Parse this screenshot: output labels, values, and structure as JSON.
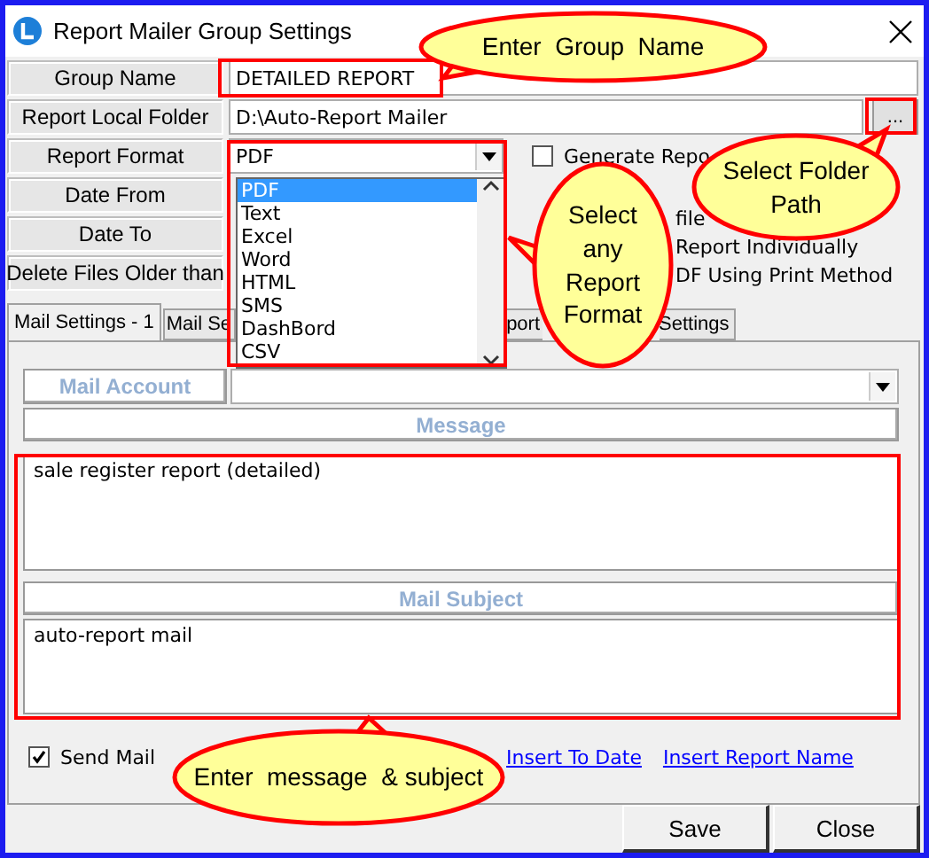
{
  "window": {
    "title": "Report Mailer Group Settings"
  },
  "fields": [
    {
      "label": "Group Name",
      "value": "DETAILED REPORT"
    },
    {
      "label": "Report Local Folder",
      "value": "D:\\Auto-Report Mailer",
      "button": "..."
    }
  ],
  "report_format": {
    "label": "Report Format",
    "value": "PDF",
    "options": [
      {
        "text": "PDF",
        "selected": true
      },
      {
        "text": "Text",
        "selected": false
      },
      {
        "text": "Excel",
        "selected": false
      },
      {
        "text": "Word",
        "selected": false
      },
      {
        "text": "HTML",
        "selected": false
      },
      {
        "text": "SMS",
        "selected": false
      },
      {
        "text": "DashBord",
        "selected": false
      },
      {
        "text": "CSV",
        "selected": false
      }
    ]
  },
  "other_labels": [
    "Date From",
    "Date To",
    "Delete Files Older than"
  ],
  "options": [
    {
      "kind": "checkbox",
      "text": "Generate Repo",
      "checked": false
    },
    {
      "kind": "text",
      "text": "file"
    },
    {
      "kind": "text",
      "text": "Report Individually"
    },
    {
      "kind": "text",
      "text": "DF Using Print Method"
    }
  ],
  "tabs": [
    {
      "label": "Mail Settings - 1",
      "selected": true
    },
    {
      "label": "Mail Se",
      "selected": false
    },
    {
      "label": "port",
      "selected": false
    },
    {
      "label": "Settings",
      "selected": false
    }
  ],
  "mail": {
    "account_label": "Mail Account",
    "message_label": "Message",
    "message": "sale register report (detailed)",
    "subject_label": "Mail Subject",
    "subject": "auto-report mail",
    "send_mail": {
      "label": "Send Mail",
      "checked": true
    },
    "links": [
      "Insert To Date",
      "Insert Report Name"
    ]
  },
  "buttons": [
    "Save",
    "Close"
  ],
  "callouts": [
    "Enter  Group  Name",
    "Select Folder  Path",
    "Select any Report Format",
    "Enter  message  & subject"
  ]
}
